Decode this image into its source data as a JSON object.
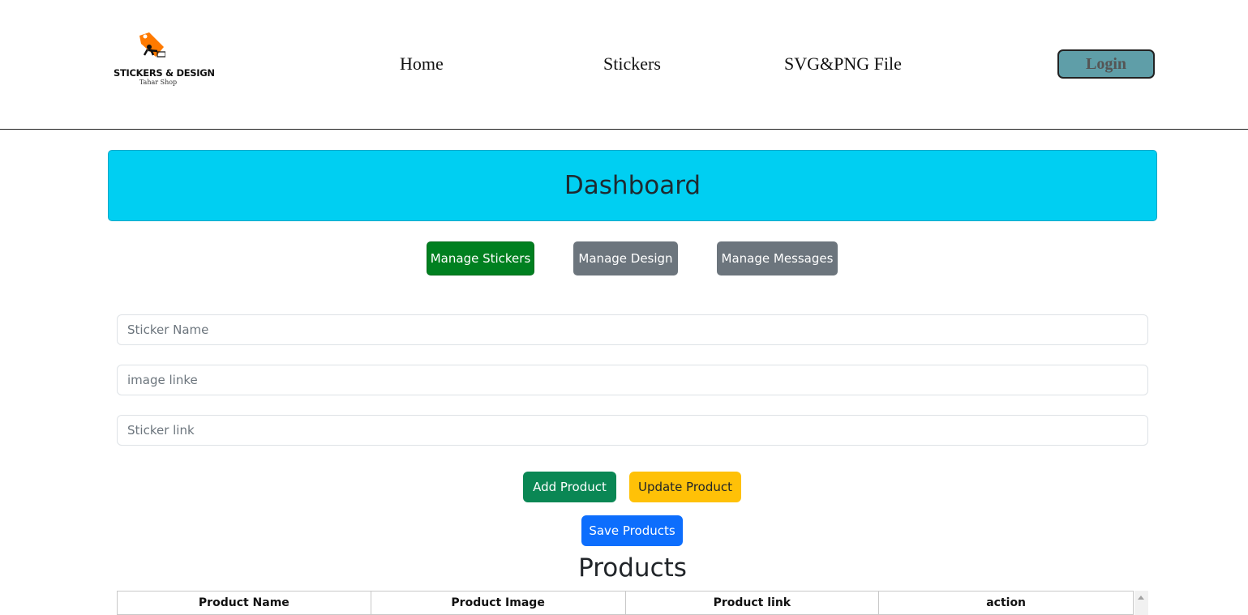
{
  "header": {
    "logo": {
      "title": "STICKERS & DESIGN",
      "subtitle": "Tahar Shop"
    },
    "nav": [
      {
        "label": "Home"
      },
      {
        "label": "Stickers"
      },
      {
        "label": "SVG&PNG File"
      }
    ],
    "login_label": "Login"
  },
  "banner": {
    "title": "Dashboard"
  },
  "tabs": [
    {
      "label": "Manage Stickers",
      "active": true
    },
    {
      "label": "Manage Design",
      "active": false
    },
    {
      "label": "Manage Messages",
      "active": false
    }
  ],
  "form": {
    "sticker_name": {
      "placeholder": "Sticker Name",
      "value": ""
    },
    "image_link": {
      "placeholder": "image linke",
      "value": ""
    },
    "sticker_link": {
      "placeholder": "Sticker link",
      "value": ""
    }
  },
  "actions": {
    "add_label": "Add Product",
    "update_label": "Update Product",
    "save_label": "Save Products"
  },
  "products": {
    "title": "Products",
    "columns": [
      "Product Name",
      "Product Image",
      "Product link",
      "action"
    ]
  },
  "colors": {
    "banner": "#00cff2",
    "active_tab": "#008020",
    "inactive_tab": "#6c757d",
    "add": "#0a8754",
    "update": "#ffc107",
    "save": "#0d6efd",
    "login": "#5f9ea8",
    "logo_tag": "#ff7a00"
  },
  "icons": {
    "logo": "price-tag-runner-cart-logo",
    "scroll": "scroll-up-arrow-icon"
  }
}
